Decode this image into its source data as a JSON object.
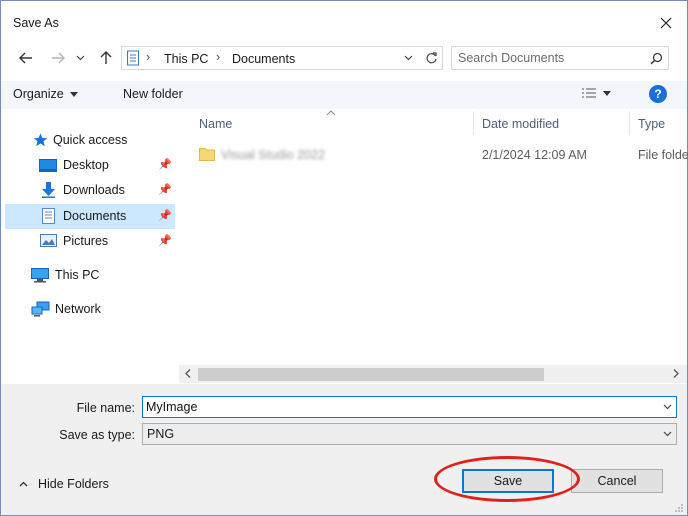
{
  "window": {
    "title": "Save As"
  },
  "address": {
    "segments": [
      "This PC",
      "Documents"
    ]
  },
  "search": {
    "placeholder": "Search Documents"
  },
  "toolbar": {
    "organize_label": "Organize",
    "new_folder_label": "New folder"
  },
  "sidebar": {
    "items": [
      {
        "label": "Quick access"
      },
      {
        "label": "Desktop"
      },
      {
        "label": "Downloads"
      },
      {
        "label": "Documents"
      },
      {
        "label": "Pictures"
      },
      {
        "label": "This PC"
      },
      {
        "label": "Network"
      }
    ],
    "selected": "Documents"
  },
  "file_list": {
    "columns": [
      "Name",
      "Date modified",
      "Type"
    ],
    "rows": [
      {
        "name": "Visual Studio 2022",
        "date_modified": "2/1/2024 12:09 AM",
        "type": "File folder"
      }
    ]
  },
  "form": {
    "file_name_label": "File name:",
    "file_name_value": "MyImage",
    "save_type_label": "Save as type:",
    "save_type_value": "PNG"
  },
  "footer": {
    "hide_folders_label": "Hide Folders",
    "save_label": "Save",
    "cancel_label": "Cancel"
  },
  "colors": {
    "accent": "#0078d7",
    "selected_bg": "#cce8ff",
    "highlight_ring": "#e0201a",
    "help_icon": "#1a6fd8"
  }
}
